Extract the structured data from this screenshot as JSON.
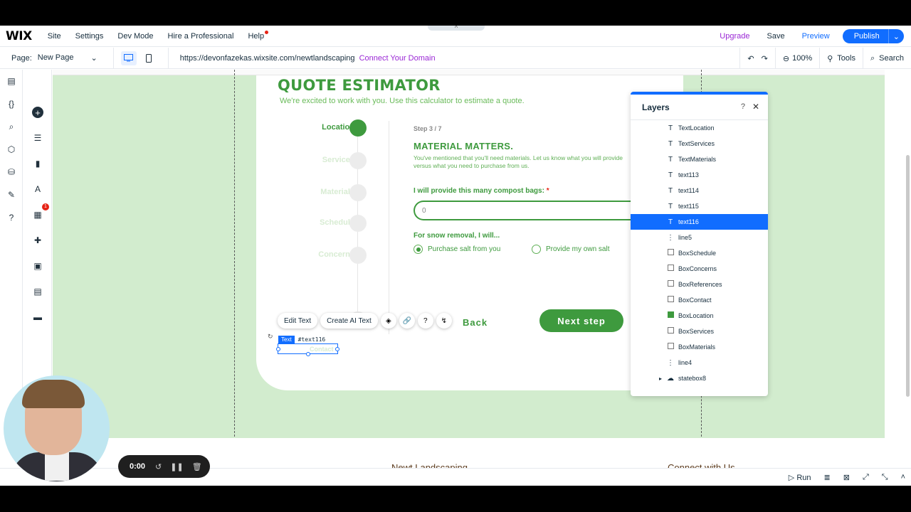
{
  "topbar": {
    "logo": "WIX",
    "menu": [
      "Site",
      "Settings",
      "Dev Mode",
      "Hire a Professional",
      "Help"
    ],
    "upgrade": "Upgrade",
    "save": "Save",
    "preview": "Preview",
    "publish": "Publish"
  },
  "secondbar": {
    "page_label": "Page:",
    "page_value": "New Page",
    "url": "https://devonfazekas.wixsite.com/newtlandscaping",
    "connect_domain": "Connect Your Domain",
    "zoom": "100%",
    "tools": "Tools",
    "search": "Search"
  },
  "leftbar": {
    "apps_badge": "1"
  },
  "quote": {
    "title": "QUOTE ESTIMATOR",
    "subtitle": "We're excited to work with you. Use this calculator to estimate a quote.",
    "steps": [
      {
        "label": "Location",
        "active": true
      },
      {
        "label": "Services",
        "active": false
      },
      {
        "label": "Materials",
        "active": false
      },
      {
        "label": "Schedule",
        "active": false
      },
      {
        "label": "Concerns",
        "active": false
      }
    ],
    "step_count": "Step 3 / 7",
    "section_title": "MATERIAL MATTERS.",
    "section_desc": "You've mentioned that you'll need materials. Let us know what you will provide versus what you need to purchase from us.",
    "compost_label": "I will provide this many compost bags:",
    "required_mark": "*",
    "compost_value": "0",
    "snow_label": "For snow removal, I will...",
    "radio_options": [
      {
        "label": "Purchase salt from you",
        "checked": true
      },
      {
        "label": "Provide my own salt",
        "checked": false
      }
    ],
    "back": "Back",
    "next": "Next step"
  },
  "floatbar": {
    "edit_text": "Edit Text",
    "create_ai_text": "Create AI Text"
  },
  "selection": {
    "type": "Text",
    "id": "#text116",
    "element_text": "Contact"
  },
  "layers": {
    "title": "Layers",
    "help": "?",
    "items": [
      {
        "name": "TextLocation",
        "icon": "text-icon",
        "selected": false
      },
      {
        "name": "TextServices",
        "icon": "text-icon",
        "selected": false
      },
      {
        "name": "TextMaterials",
        "icon": "text-icon",
        "selected": false
      },
      {
        "name": "text113",
        "icon": "text-icon",
        "selected": false
      },
      {
        "name": "text114",
        "icon": "text-icon",
        "selected": false
      },
      {
        "name": "text115",
        "icon": "text-icon",
        "selected": false
      },
      {
        "name": "text116",
        "icon": "text-icon",
        "selected": true
      },
      {
        "name": "line5",
        "icon": "line-icon",
        "selected": false
      },
      {
        "name": "BoxSchedule",
        "icon": "box-icon",
        "selected": false
      },
      {
        "name": "BoxConcerns",
        "icon": "box-icon",
        "selected": false
      },
      {
        "name": "BoxReferences",
        "icon": "box-icon",
        "selected": false
      },
      {
        "name": "BoxContact",
        "icon": "box-icon",
        "selected": false
      },
      {
        "name": "BoxLocation",
        "icon": "box-green-icon",
        "selected": false
      },
      {
        "name": "BoxServices",
        "icon": "box-icon",
        "selected": false
      },
      {
        "name": "BoxMaterials",
        "icon": "box-icon",
        "selected": false
      },
      {
        "name": "line4",
        "icon": "line-icon",
        "selected": false
      },
      {
        "name": "statebox8",
        "icon": "statebox-icon",
        "selected": false
      }
    ]
  },
  "footer": {
    "col1": "Newt Landscaping",
    "col2": "Connect with Us"
  },
  "bottombar": {
    "run": "Run"
  },
  "recorder": {
    "time": "0:00"
  },
  "colors": {
    "brand_green": "#3e9a3e",
    "wix_blue": "#116dff",
    "upgrade_purple": "#9a27d5",
    "canvas_bg": "#d2ecce"
  }
}
